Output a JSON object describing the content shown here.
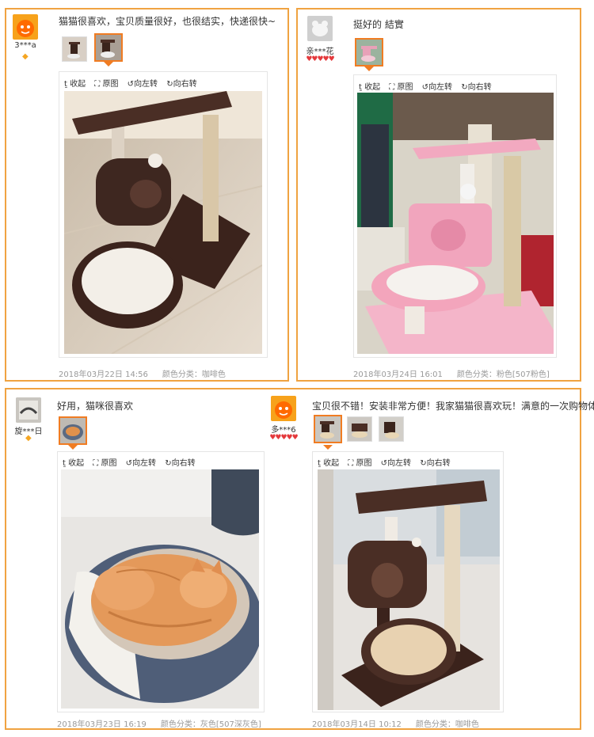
{
  "reviews": [
    {
      "user": "3***a",
      "comment": "猫猫很喜欢，宝贝质量很好，也很结实，快递很快~",
      "date": "2018年03月22日 14:56",
      "sku_label": "颜色分类：",
      "sku": "咖啡色",
      "tools": [
        "收起",
        "原图",
        "向左转",
        "向右转"
      ]
    },
    {
      "user": "亲***花",
      "comment": "挺好的 結實",
      "date": "2018年03月24日 16:01",
      "sku_label": "颜色分类：",
      "sku": "粉色[507粉色]",
      "tools": [
        "收起",
        "原图",
        "向左转",
        "向右转"
      ]
    },
    {
      "user": "旋***日",
      "comment": "好用，猫咪很喜欢",
      "date": "2018年03月23日 16:19",
      "sku_label": "颜色分类：",
      "sku": "灰色[507深灰色]",
      "tools": [
        "收起",
        "原图",
        "向左转",
        "向右转"
      ]
    },
    {
      "user": "多***6",
      "comment": "宝贝很不错！安装非常方便！我家猫猫很喜欢玩！满意的一次购物体验！",
      "date": "2018年03月14日 10:12",
      "sku_label": "颜色分类：",
      "sku": "咖啡色",
      "tools": [
        "收起",
        "原图",
        "向左转",
        "向右转"
      ]
    }
  ],
  "icons": {
    "collapse": "collapse-icon",
    "original": "expand-icon",
    "rotate_left": "rotate-left-icon",
    "rotate_right": "rotate-right-icon"
  },
  "colors": {
    "border": "#f0a341",
    "selected_thumb": "#f07c22",
    "hearts": "#e4393c",
    "meta_text": "#999999"
  }
}
